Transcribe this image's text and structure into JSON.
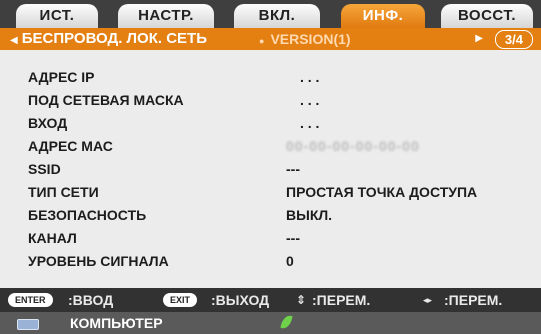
{
  "tabs": [
    "ИСТ.",
    "НАСТР.",
    "ВКЛ.",
    "ИНФ.",
    "ВОССТ."
  ],
  "active_tab_index": 3,
  "subbar": {
    "left_arrow": "◀",
    "title": "БЕСПРОВОД. ЛОК. СЕТЬ",
    "middle_marker": "●",
    "middle": "VERSION(1)",
    "right_arrow": "▶",
    "page": "3/4"
  },
  "info": [
    {
      "label": "АДРЕС IP",
      "value": ".  .  ."
    },
    {
      "label": "ПОД СЕТЕВАЯ МАСКА",
      "value": ".  .  ."
    },
    {
      "label": "ВХОД",
      "value": ".  .  ."
    },
    {
      "label": "АДРЕС МАС",
      "value": "00-00-00-00-00-00"
    },
    {
      "label": "SSID",
      "value": "---"
    },
    {
      "label": "ТИП СЕТИ",
      "value": "ПРОСТАЯ ТОЧКА ДОСТУПА"
    },
    {
      "label": "БЕЗОПАСНОСТЬ",
      "value": "ВЫКЛ."
    },
    {
      "label": "КАНАЛ",
      "value": "---"
    },
    {
      "label": "УРОВЕНЬ СИГНАЛА",
      "value": "0"
    }
  ],
  "help": {
    "enter_key": "ENTER",
    "enter_label": ":ВВОД",
    "exit_key": "EXIT",
    "exit_label": ":ВЫХОД",
    "updown_icon": "⇕",
    "updown_label": ":ПЕРЕМ.",
    "leftright_icon": "◂▸",
    "leftright_label": ":ПЕРЕМ."
  },
  "source": {
    "label": "КОМПЬЮТЕР",
    "icon": "monitor-icon",
    "eco_icon": "leaf-icon"
  },
  "colors": {
    "accent": "#e47f12",
    "tab_bar": "#3f3f3f",
    "panel": "#ececec"
  }
}
